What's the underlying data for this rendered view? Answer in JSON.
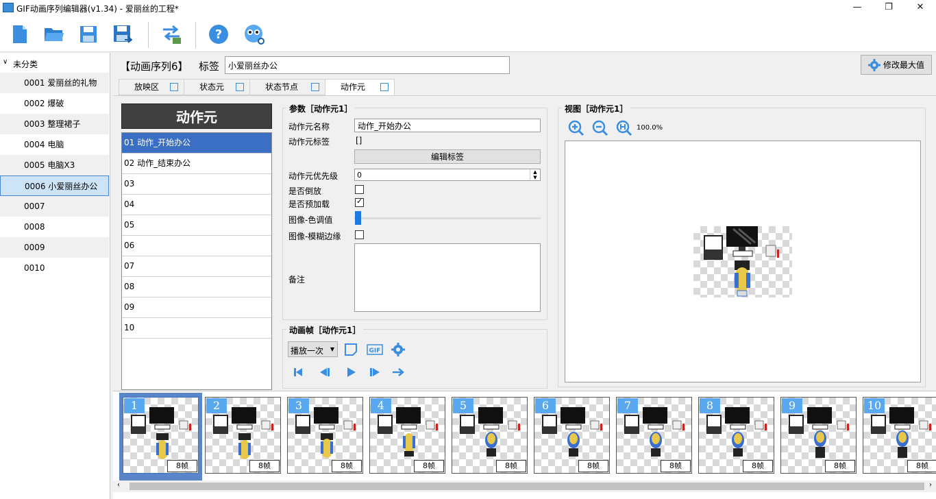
{
  "window": {
    "title": "GIF动画序列编辑器(v1.34) - 爱丽丝的工程*",
    "minimize": "—",
    "restore": "❐",
    "close": "✕"
  },
  "toolbar": {
    "icons": [
      "new-file-icon",
      "open-folder-icon",
      "save-icon",
      "save-as-icon",
      "convert-icon",
      "help-icon",
      "about-icon"
    ]
  },
  "tree": {
    "root": "未分类",
    "items": [
      {
        "label": "0001 爱丽丝的礼物"
      },
      {
        "label": "0002 爆破"
      },
      {
        "label": "0003 整理裙子"
      },
      {
        "label": "0004 电脑"
      },
      {
        "label": "0005 电脑X3"
      },
      {
        "label": "0006 小爱丽丝办公"
      },
      {
        "label": "0007"
      },
      {
        "label": "0008"
      },
      {
        "label": "0009"
      },
      {
        "label": "0010"
      }
    ],
    "selected_index": 5
  },
  "header": {
    "sequence": "【动画序列6】",
    "tag_label": "标签",
    "tag_value": "小爱丽丝办公",
    "max_button": "修改最大值"
  },
  "tabs": [
    {
      "label": "放映区"
    },
    {
      "label": "状态元"
    },
    {
      "label": "状态节点"
    },
    {
      "label": "动作元"
    }
  ],
  "active_tab": 3,
  "anim_list": {
    "header": "动作元",
    "items": [
      "01 动作_开始办公",
      "02 动作_结束办公",
      "03",
      "04",
      "05",
      "06",
      "07",
      "08",
      "09",
      "10"
    ],
    "selected_index": 0
  },
  "params": {
    "title": "参数［动作元1］",
    "name_label": "动作元名称",
    "name_value": "动作_开始办公",
    "tag_label": "动作元标签",
    "tag_value": "[]",
    "edit_tag_button": "编辑标签",
    "priority_label": "动作元优先级",
    "priority_value": "0",
    "reverse_label": "是否倒放",
    "reverse_checked": false,
    "preload_label": "是否预加载",
    "preload_checked": true,
    "hue_label": "图像-色调值",
    "hue_value": 0,
    "blur_label": "图像-模糊边缘",
    "blur_checked": false,
    "note_label": "备注",
    "note_value": ""
  },
  "anim_frames": {
    "title": "动画帧［动作元1］",
    "play_mode": "播放一次",
    "icons": [
      "new-frame-icon",
      "gif-icon",
      "settings-icon"
    ],
    "playback_icons": [
      "first-frame-icon",
      "prev-frame-icon",
      "play-icon",
      "next-frame-icon",
      "loop-icon"
    ]
  },
  "view": {
    "title": "视图［动作元1］",
    "zoom": "100.0%",
    "icons": [
      "zoom-in-icon",
      "zoom-out-icon",
      "zoom-fit-icon"
    ]
  },
  "frames": [
    {
      "num": "1",
      "dur": "8帧"
    },
    {
      "num": "2",
      "dur": "8帧"
    },
    {
      "num": "3",
      "dur": "8帧"
    },
    {
      "num": "4",
      "dur": "8帧"
    },
    {
      "num": "5",
      "dur": "8帧"
    },
    {
      "num": "6",
      "dur": "8帧"
    },
    {
      "num": "7",
      "dur": "8帧"
    },
    {
      "num": "8",
      "dur": "8帧"
    },
    {
      "num": "9",
      "dur": "8帧"
    },
    {
      "num": "10",
      "dur": "8帧"
    }
  ],
  "selected_frame": 0,
  "colors": {
    "accent": "#3b6fc4",
    "icon_blue": "#3a8ee0",
    "frame_badge": "#5aa9f0"
  }
}
